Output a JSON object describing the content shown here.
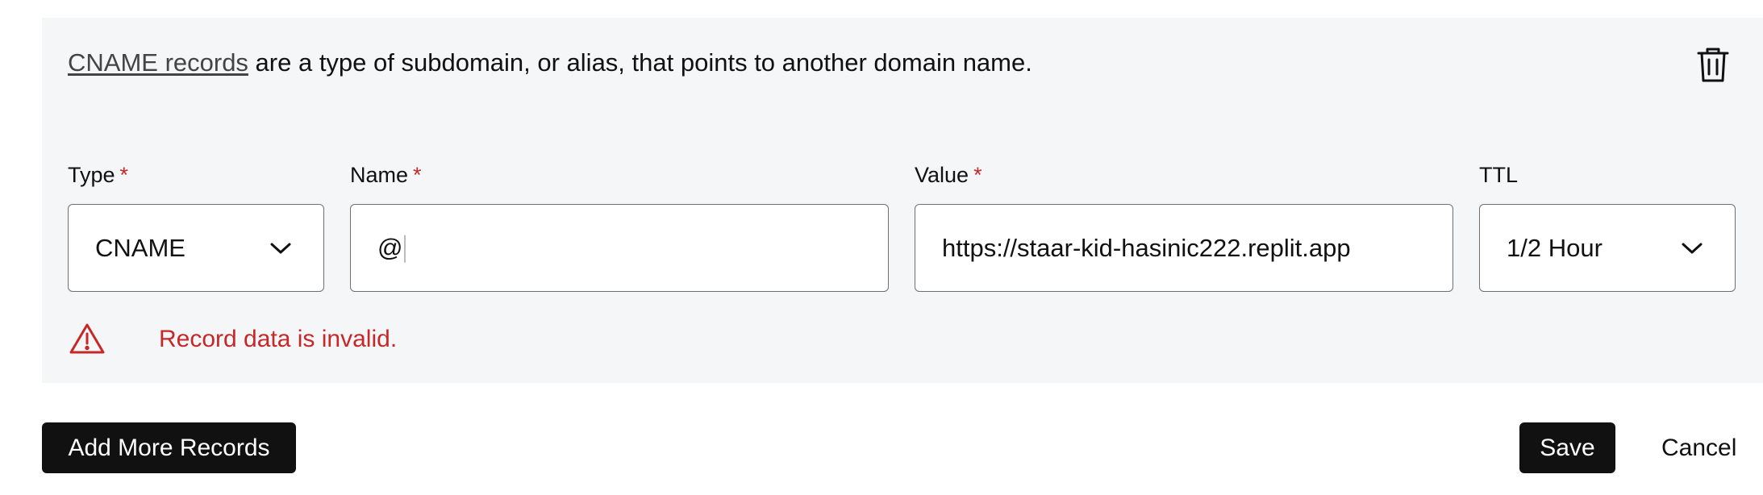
{
  "record": {
    "description_link": "CNAME records",
    "description_rest": " are a type of subdomain, or alias, that points to another domain name.",
    "delete_icon": "trash-icon"
  },
  "fields": {
    "type": {
      "label": "Type",
      "required_mark": "*",
      "value": "CNAME",
      "icon": "chevron-down-icon"
    },
    "name": {
      "label": "Name",
      "required_mark": "*",
      "value": "@"
    },
    "value": {
      "label": "Value",
      "required_mark": "*",
      "value": "https://staar-kid-hasinic222.replit.app"
    },
    "ttl": {
      "label": "TTL",
      "value": "1/2 Hour",
      "icon": "chevron-down-icon"
    }
  },
  "error": {
    "icon": "warning-icon",
    "message": "Record data is invalid."
  },
  "actions": {
    "add_more": "Add More Records",
    "save": "Save",
    "cancel": "Cancel"
  },
  "colors": {
    "panel_bg": "#f5f6f8",
    "error": "#c62828",
    "button_dark": "#111111"
  }
}
